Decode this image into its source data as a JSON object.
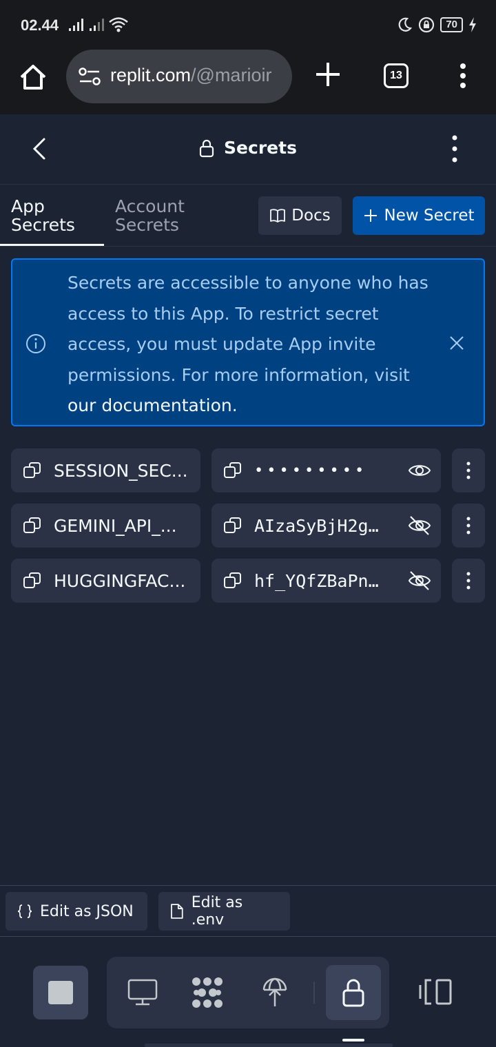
{
  "status_bar": {
    "time": "02.44",
    "battery": "70"
  },
  "browser": {
    "url_host": "replit.com",
    "url_path": "/@marioir",
    "tab_count": "13"
  },
  "header": {
    "title": "Secrets"
  },
  "tabs": [
    {
      "label": "App\nSecrets",
      "active": true
    },
    {
      "label": "Account\nSecrets",
      "active": false
    }
  ],
  "tab_labels": {
    "app_line1": "App",
    "app_line2": "Secrets",
    "account_line1": "Account",
    "account_line2": "Secrets"
  },
  "actions": {
    "docs_label": "Docs",
    "new_secret_label": "New Secret"
  },
  "banner": {
    "text": "Secrets are accessible to anyone who has access to this App. To restrict secret access, you must update App invite permissions. For more information, visit ",
    "link_text": "our documentation."
  },
  "secrets": [
    {
      "key": "SESSION_SECRET",
      "key_display": "SESSION_SEC...",
      "value": "•••••••••",
      "visible": false
    },
    {
      "key": "GEMINI_API_KEY",
      "key_display": "GEMINI_API_...",
      "value": "AIzaSyBjH2g…",
      "visible": true
    },
    {
      "key": "HUGGINGFACE",
      "key_display": "HUGGINGFAC...",
      "value": "hf_YQfZBaPn…",
      "visible": true
    }
  ],
  "footer": {
    "edit_json_label": "Edit as JSON",
    "edit_env_label": "Edit as .env"
  },
  "colors": {
    "background": "#1c2333",
    "surface": "#2b3245",
    "primary": "#0053a6",
    "banner_bg": "#004182",
    "banner_border": "#0079f2",
    "banner_text": "#a8cdf3",
    "browser_chrome": "#17191d"
  },
  "icons": {
    "home": "home-icon",
    "back": "chevron-left-icon",
    "lock": "lock-icon",
    "docs": "book-icon",
    "new": "plus-icon",
    "info": "info-icon",
    "close": "close-icon",
    "copy": "copy-icon",
    "eye": "eye-icon",
    "eye_off": "eye-off-icon",
    "more": "more-vertical-icon"
  }
}
